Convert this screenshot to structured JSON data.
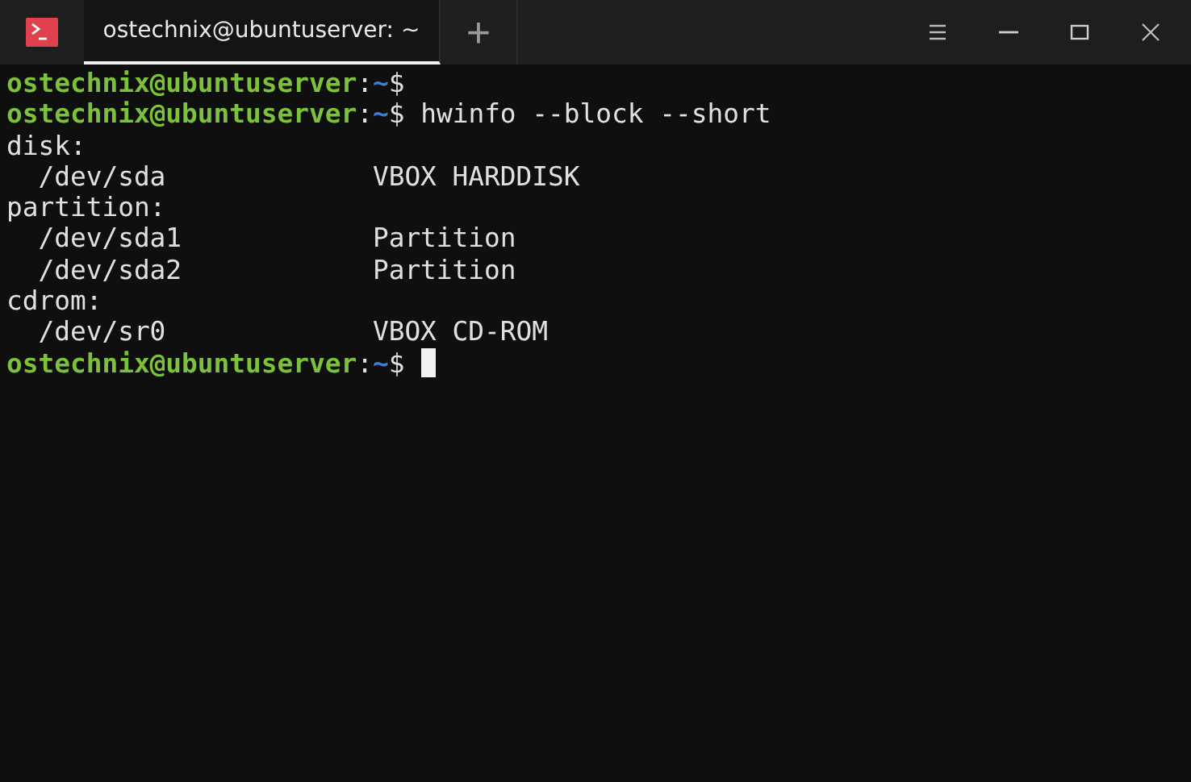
{
  "window": {
    "tab_title": "ostechnix@ubuntuserver: ~",
    "new_tab": "+"
  },
  "lines": [
    {
      "kind": "prompt",
      "user": "ostechnix@ubuntuserver",
      "separator": ":",
      "path": "~",
      "symbol": "$",
      "cursor": false
    },
    {
      "kind": "prompt",
      "user": "ostechnix@ubuntuserver",
      "separator": ":",
      "path": "~",
      "symbol": "$",
      "command": "hwinfo --block --short",
      "cursor": false
    },
    {
      "kind": "heading",
      "text": "disk:"
    },
    {
      "kind": "entry",
      "device": "/dev/sda",
      "description": "VBOX HARDDISK"
    },
    {
      "kind": "heading",
      "text": "partition:"
    },
    {
      "kind": "entry",
      "device": "/dev/sda1",
      "description": "Partition"
    },
    {
      "kind": "entry",
      "device": "/dev/sda2",
      "description": "Partition"
    },
    {
      "kind": "heading",
      "text": "cdrom:"
    },
    {
      "kind": "entry",
      "device": "/dev/sr0",
      "description": "VBOX CD-ROM"
    },
    {
      "kind": "prompt",
      "user": "ostechnix@ubuntuserver",
      "separator": ":",
      "path": "~",
      "symbol": "$",
      "cursor": true
    }
  ]
}
